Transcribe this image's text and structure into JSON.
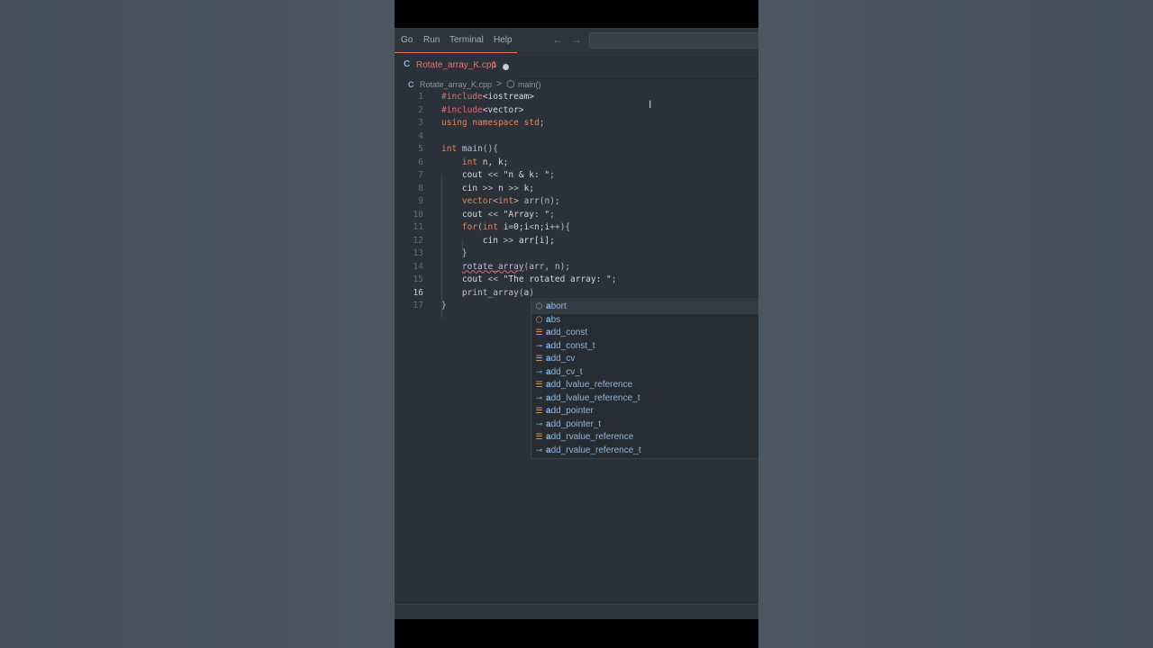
{
  "menubar": {
    "items": [
      "Go",
      "Run",
      "Terminal",
      "Help"
    ],
    "back_arrow": "←",
    "forward_arrow": "→"
  },
  "tab": {
    "icon": "C",
    "label": "Rotate_array_K.cpp",
    "problem_count": "1"
  },
  "breadcrumb": {
    "file": "Rotate_array_K.cpp",
    "separator": ">",
    "symbol": "main()"
  },
  "code": {
    "current_line": 16,
    "lines": [
      {
        "n": "1",
        "parts": [
          [
            "pp",
            "#include"
          ],
          [
            "st",
            "<iostream>"
          ]
        ]
      },
      {
        "n": "2",
        "parts": [
          [
            "pp",
            "#include"
          ],
          [
            "st",
            "<vector>"
          ]
        ]
      },
      {
        "n": "3",
        "parts": [
          [
            "kw",
            "using"
          ],
          [
            "op",
            " "
          ],
          [
            "kw",
            "namespace"
          ],
          [
            "op",
            " "
          ],
          [
            "ty",
            "std"
          ],
          [
            "op",
            ";"
          ]
        ]
      },
      {
        "n": "4",
        "parts": []
      },
      {
        "n": "5",
        "parts": [
          [
            "ty",
            "int"
          ],
          [
            "op",
            " "
          ],
          [
            "fn",
            "main"
          ],
          [
            "op",
            "(){"
          ]
        ]
      },
      {
        "n": "6",
        "parts": [
          [
            "op",
            "    "
          ],
          [
            "ty",
            "int"
          ],
          [
            "id",
            " n, k;"
          ]
        ]
      },
      {
        "n": "7",
        "parts": [
          [
            "op",
            "    "
          ],
          [
            "id",
            "cout "
          ],
          [
            "op",
            "<< "
          ],
          [
            "st",
            "\"n & k: \""
          ],
          [
            "op",
            ";"
          ]
        ]
      },
      {
        "n": "8",
        "parts": [
          [
            "op",
            "    "
          ],
          [
            "id",
            "cin "
          ],
          [
            "op",
            ">> "
          ],
          [
            "id",
            "n "
          ],
          [
            "op",
            ">> "
          ],
          [
            "id",
            "k;"
          ]
        ]
      },
      {
        "n": "9",
        "parts": [
          [
            "op",
            "    "
          ],
          [
            "ty",
            "vector"
          ],
          [
            "op",
            "<"
          ],
          [
            "ty",
            "int"
          ],
          [
            "op",
            "> "
          ],
          [
            "fn",
            "arr"
          ],
          [
            "op",
            "(n);"
          ]
        ]
      },
      {
        "n": "10",
        "parts": [
          [
            "op",
            "    "
          ],
          [
            "id",
            "cout "
          ],
          [
            "op",
            "<< "
          ],
          [
            "st",
            "\"Array: \""
          ],
          [
            "op",
            ";"
          ]
        ]
      },
      {
        "n": "11",
        "parts": [
          [
            "op",
            "    "
          ],
          [
            "kw",
            "for"
          ],
          [
            "op",
            "("
          ],
          [
            "ty",
            "int"
          ],
          [
            "id",
            " i"
          ],
          [
            "op",
            "="
          ],
          [
            "id",
            "0;i"
          ],
          [
            "op",
            "<"
          ],
          [
            "id",
            "n;i"
          ],
          [
            "op",
            "++"
          ],
          [
            "op",
            "){"
          ]
        ]
      },
      {
        "n": "12",
        "parts": [
          [
            "op",
            "        "
          ],
          [
            "id",
            "cin "
          ],
          [
            "op",
            ">> "
          ],
          [
            "id",
            "arr[i];"
          ]
        ]
      },
      {
        "n": "13",
        "parts": [
          [
            "op",
            "    "
          ],
          [
            "op",
            "}"
          ]
        ]
      },
      {
        "n": "14",
        "parts": [
          [
            "op",
            "    "
          ],
          [
            "fn squig",
            "rotate_array"
          ],
          [
            "op",
            "(arr, n);"
          ]
        ]
      },
      {
        "n": "15",
        "parts": [
          [
            "op",
            "    "
          ],
          [
            "id",
            "cout "
          ],
          [
            "op",
            "<< "
          ],
          [
            "st",
            "\"The rotated array: \""
          ],
          [
            "op",
            ";"
          ]
        ]
      },
      {
        "n": "16",
        "parts": [
          [
            "op",
            "    "
          ],
          [
            "fn",
            "print_array"
          ],
          [
            "op",
            "("
          ],
          [
            "id",
            "a"
          ],
          [
            "op",
            ")"
          ]
        ]
      },
      {
        "n": "17",
        "parts": [
          [
            "op",
            "}"
          ]
        ]
      }
    ]
  },
  "suggestions": [
    {
      "kind": "function",
      "icon": "cube-icon",
      "match": "a",
      "rest": "bort"
    },
    {
      "kind": "function",
      "icon": "cube-icon",
      "match": "a",
      "rest": "bs"
    },
    {
      "kind": "class",
      "icon": "class-icon",
      "match": "a",
      "rest": "dd_const"
    },
    {
      "kind": "alias",
      "icon": "type-alias-icon",
      "match": "a",
      "rest": "dd_const_t"
    },
    {
      "kind": "class",
      "icon": "class-icon",
      "match": "a",
      "rest": "dd_cv"
    },
    {
      "kind": "alias",
      "icon": "type-alias-icon",
      "match": "a",
      "rest": "dd_cv_t"
    },
    {
      "kind": "class",
      "icon": "class-icon",
      "match": "a",
      "rest": "dd_lvalue_reference"
    },
    {
      "kind": "alias",
      "icon": "type-alias-icon",
      "match": "a",
      "rest": "dd_lvalue_reference_t"
    },
    {
      "kind": "class",
      "icon": "class-icon",
      "match": "a",
      "rest": "dd_pointer"
    },
    {
      "kind": "alias",
      "icon": "type-alias-icon",
      "match": "a",
      "rest": "dd_pointer_t"
    },
    {
      "kind": "class",
      "icon": "class-icon",
      "match": "a",
      "rest": "dd_rvalue_reference"
    },
    {
      "kind": "alias",
      "icon": "type-alias-icon",
      "match": "a",
      "rest": "dd_rvalue_reference_t"
    }
  ],
  "colors": {
    "accent_tab": "#e27b53",
    "error_text": "#e07a6d",
    "editor_bg": "#2b3138"
  }
}
